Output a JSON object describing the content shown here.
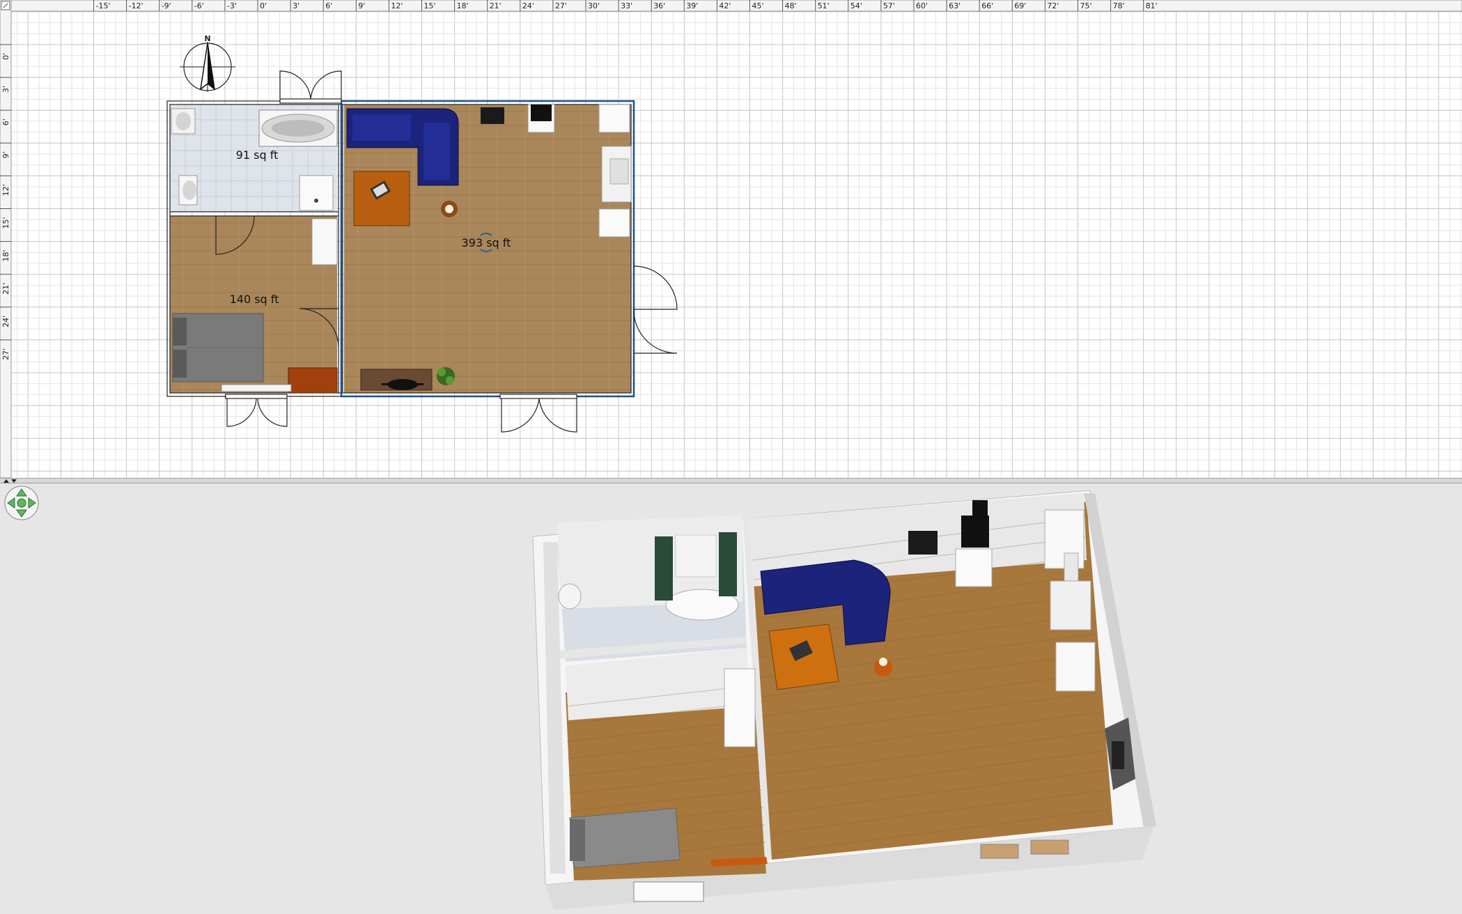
{
  "ruler": {
    "top_labels": [
      "-15'",
      "-12'",
      "-9'",
      "-6'",
      "-3'",
      "0'",
      "3'",
      "6'",
      "9'",
      "12'",
      "15'",
      "18'",
      "21'",
      "24'",
      "27'",
      "30'",
      "33'",
      "36'",
      "39'",
      "42'",
      "45'",
      "48'",
      "51'",
      "54'",
      "57'",
      "60'",
      "63'",
      "66'",
      "69'",
      "72'",
      "75'",
      "78'",
      "81'"
    ],
    "left_labels": [
      "0'",
      "3'",
      "6'",
      "9'",
      "12'",
      "15'",
      "18'",
      "21'",
      "24'",
      "27'"
    ]
  },
  "compass": {
    "label": "N"
  },
  "rooms": [
    {
      "id": "bathroom",
      "area": "91 sq ft"
    },
    {
      "id": "bedroom",
      "area": "140 sq ft"
    },
    {
      "id": "living",
      "area": "393 sq ft"
    }
  ],
  "colors": {
    "grid_minor": "#e4e4e4",
    "grid_major": "#c4c4c4",
    "floor_wood": "#a9875a",
    "tile": "#dfe3ea",
    "sofa": "#1b237a",
    "table": "#b86010",
    "bed": "#7a7a7a",
    "view_background": "#e6e6e6",
    "navigator": "#5fb85f"
  },
  "icons": [
    "compass-icon",
    "navigator-arrows-icon",
    "ruler-corner-icon"
  ]
}
